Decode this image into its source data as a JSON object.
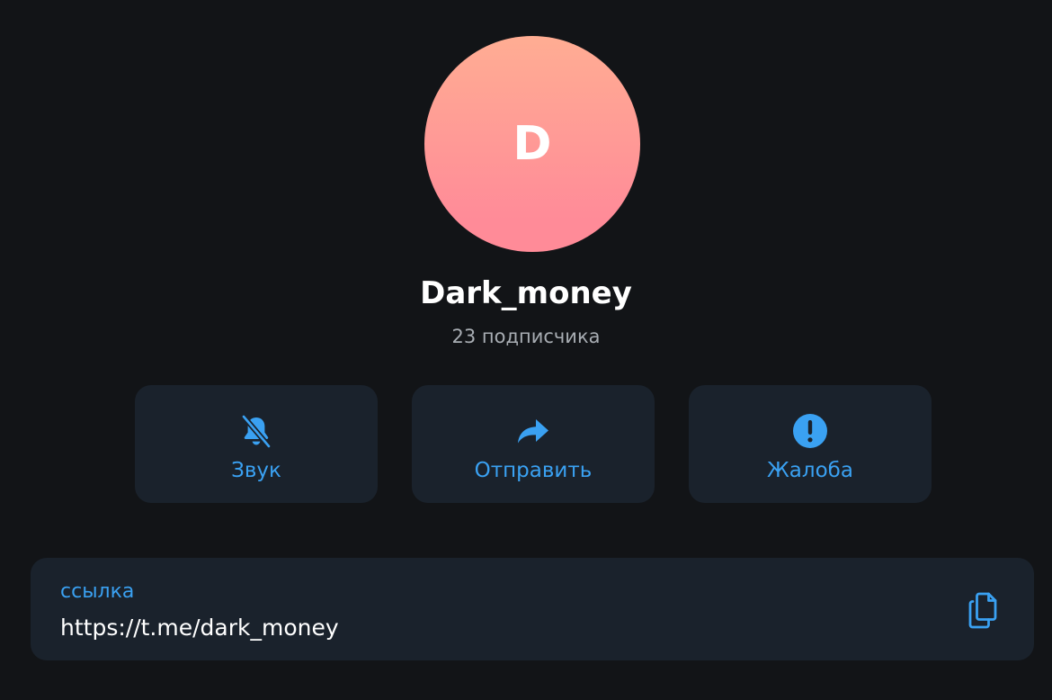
{
  "profile": {
    "avatar_letter": "D",
    "name": "Dark_money",
    "subscribers": "23 подписчика"
  },
  "actions": [
    {
      "label": "Звук",
      "icon": "bell-off-icon"
    },
    {
      "label": "Отправить",
      "icon": "share-arrow-icon"
    },
    {
      "label": "Жалоба",
      "icon": "exclamation-icon"
    }
  ],
  "link": {
    "label": "ссылка",
    "value": "https://t.me/dark_money",
    "copy_icon": "copy-icon"
  },
  "colors": {
    "background": "#121417",
    "card": "#1a222c",
    "accent": "#3aa1f2",
    "avatar_gradient_top": "#ffad93",
    "avatar_gradient_bottom": "#ff8b98",
    "secondary_text": "#a8adb3"
  }
}
